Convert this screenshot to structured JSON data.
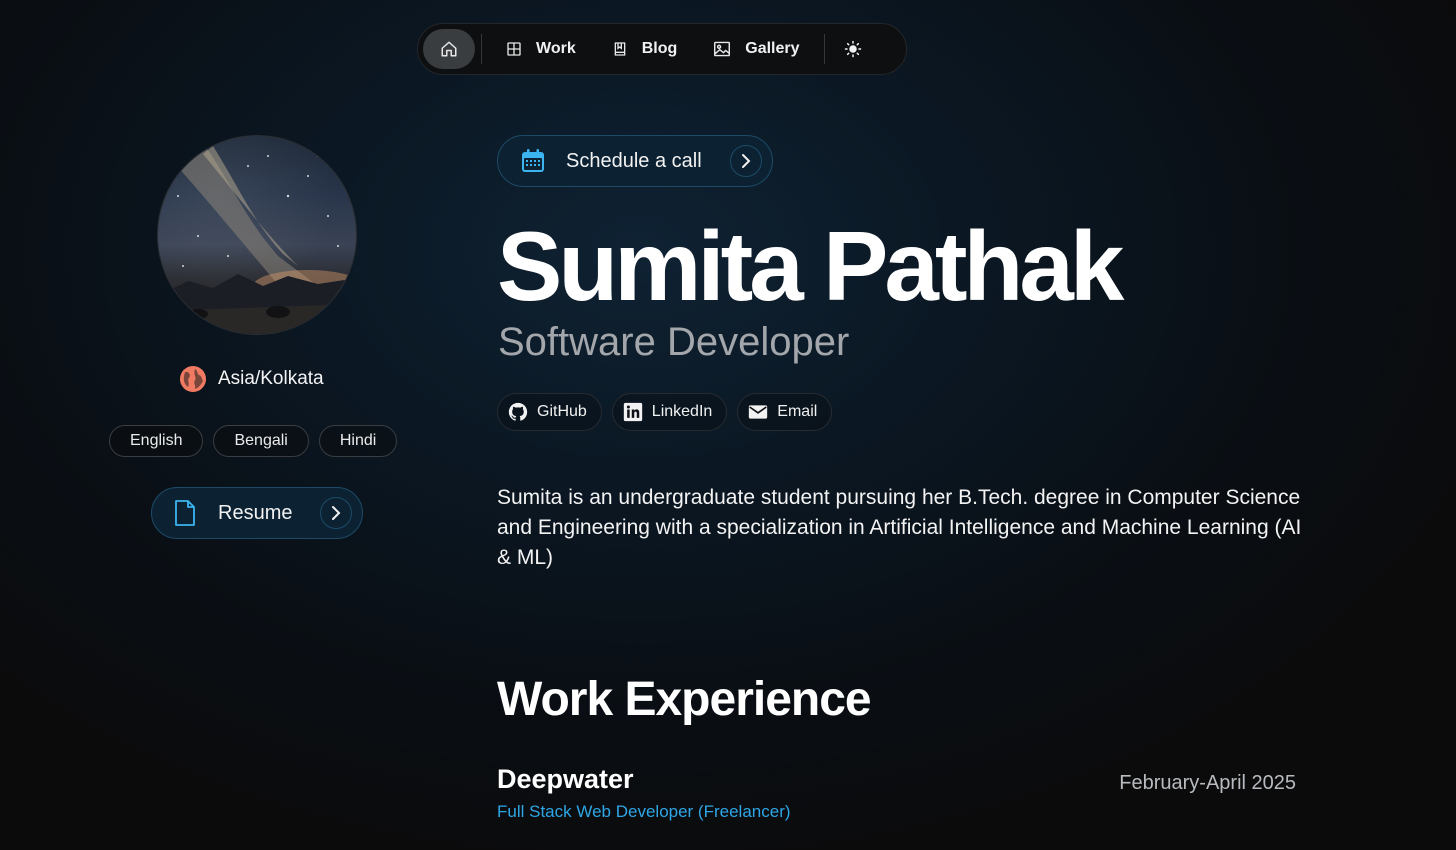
{
  "nav": {
    "items": [
      {
        "label": "Work",
        "icon": "grid-icon"
      },
      {
        "label": "Blog",
        "icon": "book-icon"
      },
      {
        "label": "Gallery",
        "icon": "image-icon"
      }
    ],
    "home_icon": "home-icon",
    "theme_icon": "sun-icon"
  },
  "profile": {
    "timezone": "Asia/Kolkata",
    "languages": [
      "English",
      "Bengali",
      "Hindi"
    ],
    "resume_label": "Resume"
  },
  "hero": {
    "schedule_label": "Schedule a call",
    "name": "Sumita Pathak",
    "role": "Software Developer",
    "socials": [
      {
        "label": "GitHub",
        "icon": "github-icon"
      },
      {
        "label": "LinkedIn",
        "icon": "linkedin-icon"
      },
      {
        "label": "Email",
        "icon": "email-icon"
      }
    ],
    "bio": "Sumita is an undergraduate student pursuing her B.Tech. degree in Computer Science and Engineering with a specialization in Artificial Intelligence and Machine Learning (AI & ML)"
  },
  "work": {
    "title": "Work Experience",
    "entries": [
      {
        "company": "Deepwater",
        "date": "February-April 2025",
        "position": "Full Stack Web Developer (Freelancer)"
      }
    ]
  },
  "colors": {
    "accent": "#2ea6e6",
    "globe": "#f07a62"
  }
}
